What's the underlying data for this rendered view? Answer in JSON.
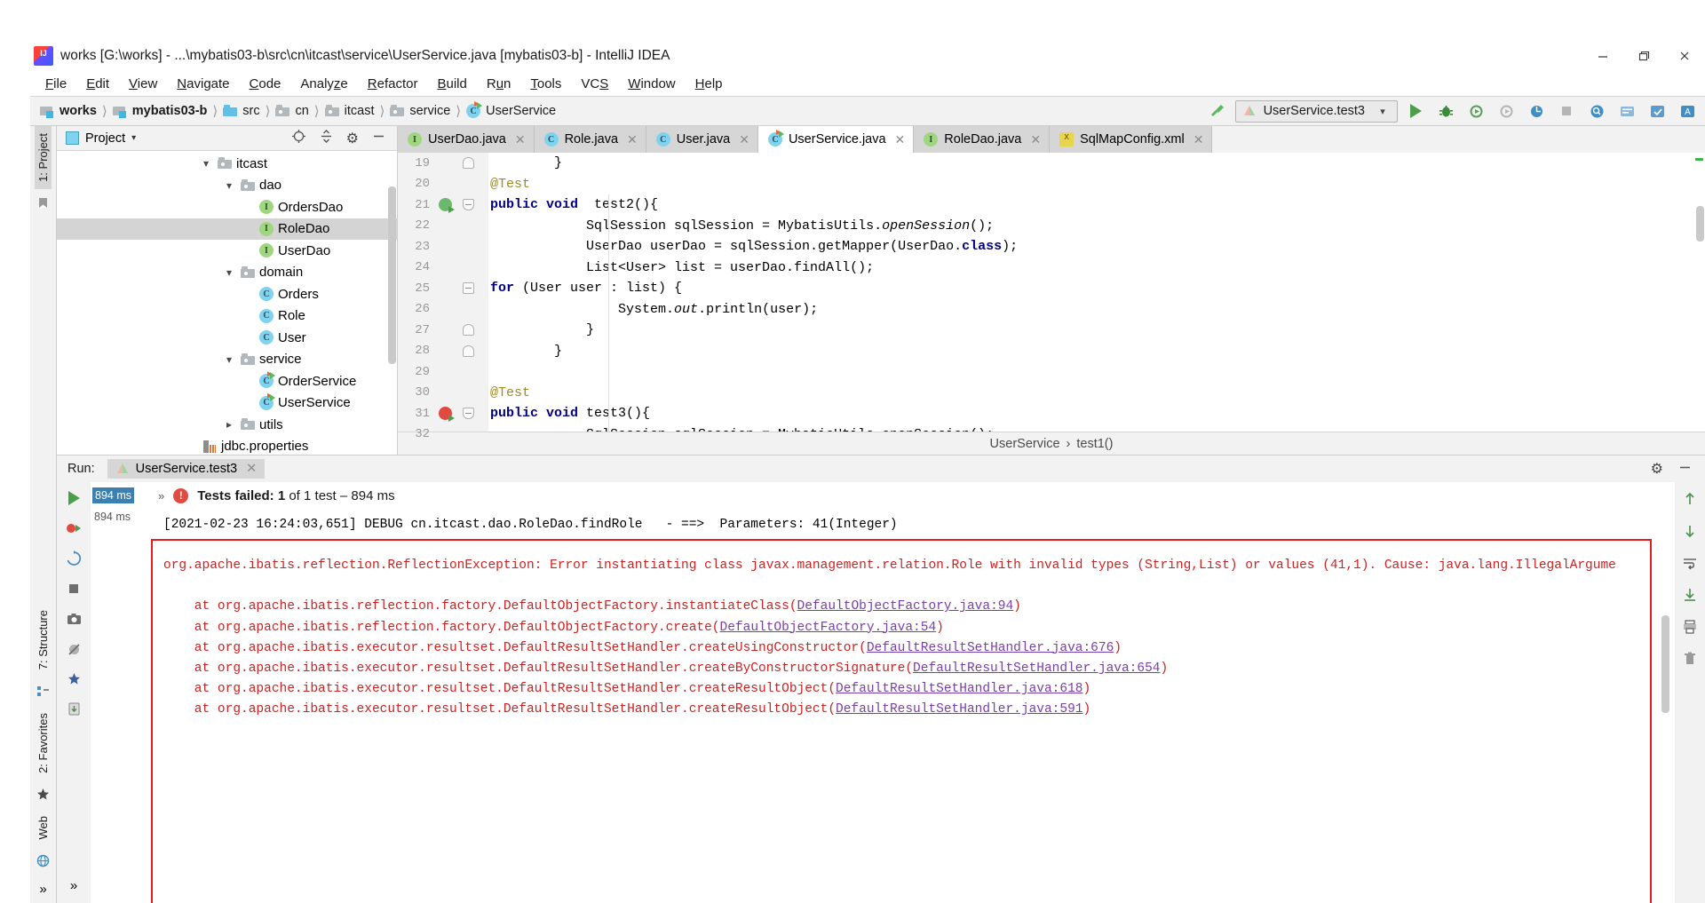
{
  "window": {
    "title": "works [G:\\works] - ...\\mybatis03-b\\src\\cn\\itcast\\service\\UserService.java [mybatis03-b] - IntelliJ IDEA",
    "app_icon": "intellij-idea-icon",
    "controls": {
      "minimize": "minimize-icon",
      "restore": "restore-icon",
      "close": "close-icon"
    }
  },
  "menubar": [
    {
      "label": "File",
      "mnemonic": "F"
    },
    {
      "label": "Edit",
      "mnemonic": "E"
    },
    {
      "label": "View",
      "mnemonic": "V"
    },
    {
      "label": "Navigate",
      "mnemonic": "N"
    },
    {
      "label": "Code",
      "mnemonic": "C"
    },
    {
      "label": "Analyze",
      "mnemonic": "z"
    },
    {
      "label": "Refactor",
      "mnemonic": "R"
    },
    {
      "label": "Build",
      "mnemonic": "B"
    },
    {
      "label": "Run",
      "mnemonic": "u"
    },
    {
      "label": "Tools",
      "mnemonic": "T"
    },
    {
      "label": "VCS",
      "mnemonic": "S"
    },
    {
      "label": "Window",
      "mnemonic": "W"
    },
    {
      "label": "Help",
      "mnemonic": "H"
    }
  ],
  "breadcrumb": [
    {
      "label": "works",
      "icon": "module-icon",
      "bold": true
    },
    {
      "label": "mybatis03-b",
      "icon": "module-icon",
      "bold": true
    },
    {
      "label": "src",
      "icon": "source-folder-icon",
      "bold": false
    },
    {
      "label": "cn",
      "icon": "package-folder-icon",
      "bold": false
    },
    {
      "label": "itcast",
      "icon": "package-folder-icon",
      "bold": false
    },
    {
      "label": "service",
      "icon": "package-folder-icon",
      "bold": false
    },
    {
      "label": "UserService",
      "icon": "java-class-runnable-icon",
      "bold": false
    }
  ],
  "toolbar": {
    "build_icon": "hammer-icon",
    "run_config": "UserService.test3",
    "run_config_icon": "junit-icon",
    "dropdown_icon": "chevron-down-icon",
    "run_icon": "run-icon",
    "debug_icon": "debug-icon",
    "run_coverage_icon": "run-with-coverage-icon",
    "profile_icon": "profile-icon",
    "stop_icon": "stop-icon",
    "search_icon": "search-everywhere-icon",
    "settings_icon": "settings-icon",
    "updates_icon": "updates-icon",
    "translate_icon": "translate-icon"
  },
  "left_strip": {
    "project_tab": "1: Project",
    "structure_tab": "7: Structure",
    "favorites_tab": "2: Favorites",
    "web_tab": "Web",
    "bookmark_icon": "bookmark-icon"
  },
  "project_panel": {
    "title": "Project",
    "title_icon": "project-view-icon",
    "dropdown_icon": "chevron-down-icon",
    "locate_icon": "scroll-from-source-icon",
    "collapse_icon": "collapse-all-icon",
    "settings_icon": "gear-icon",
    "hide_icon": "hide-icon",
    "tree": [
      {
        "label": "itcast",
        "icon": "package-folder-icon",
        "indent": 3,
        "chevron": "expanded",
        "selected": false
      },
      {
        "label": "dao",
        "icon": "package-folder-icon",
        "indent": 4,
        "chevron": "expanded",
        "selected": false
      },
      {
        "label": "OrdersDao",
        "icon": "interface-icon",
        "indent": 5,
        "chevron": "none",
        "selected": false
      },
      {
        "label": "RoleDao",
        "icon": "interface-icon",
        "indent": 5,
        "chevron": "none",
        "selected": true
      },
      {
        "label": "UserDao",
        "icon": "interface-icon",
        "indent": 5,
        "chevron": "none",
        "selected": false
      },
      {
        "label": "domain",
        "icon": "package-folder-icon",
        "indent": 4,
        "chevron": "expanded",
        "selected": false
      },
      {
        "label": "Orders",
        "icon": "class-icon",
        "indent": 5,
        "chevron": "none",
        "selected": false
      },
      {
        "label": "Role",
        "icon": "class-icon",
        "indent": 5,
        "chevron": "none",
        "selected": false
      },
      {
        "label": "User",
        "icon": "class-icon",
        "indent": 5,
        "chevron": "none",
        "selected": false
      },
      {
        "label": "service",
        "icon": "package-folder-icon",
        "indent": 4,
        "chevron": "expanded",
        "selected": false
      },
      {
        "label": "OrderService",
        "icon": "class-runnable-icon",
        "indent": 5,
        "chevron": "none",
        "selected": false
      },
      {
        "label": "UserService",
        "icon": "class-runnable-icon",
        "indent": 5,
        "chevron": "none",
        "selected": false
      },
      {
        "label": "utils",
        "icon": "package-folder-icon",
        "indent": 4,
        "chevron": "collapsed",
        "selected": false
      },
      {
        "label": "jdbc.properties",
        "icon": "properties-file-icon",
        "indent": 4,
        "chevron": "none",
        "selected": false
      }
    ]
  },
  "editor_tabs": [
    {
      "label": "UserDao.java",
      "icon": "interface-icon",
      "active": false
    },
    {
      "label": "Role.java",
      "icon": "class-icon",
      "active": false
    },
    {
      "label": "User.java",
      "icon": "class-icon",
      "active": false
    },
    {
      "label": "UserService.java",
      "icon": "class-runnable-icon",
      "active": true
    },
    {
      "label": "RoleDao.java",
      "icon": "interface-icon",
      "active": false
    },
    {
      "label": "SqlMapConfig.xml",
      "icon": "xml-file-icon",
      "active": false
    }
  ],
  "editor": {
    "lines": [
      {
        "num": "19",
        "fold": "end",
        "gutter_run": "none",
        "html": "        }"
      },
      {
        "num": "20",
        "fold": "none",
        "gutter_run": "none",
        "html": "        <span class=\"ann\">@Test</span>"
      },
      {
        "num": "21",
        "fold": "start",
        "gutter_run": "ok",
        "html": "        <span class=\"kw\">public void</span>  test2(){"
      },
      {
        "num": "22",
        "fold": "none",
        "gutter_run": "none",
        "html": "            SqlSession sqlSession = MybatisUtils.<span class=\"itl\">openSession</span>();"
      },
      {
        "num": "23",
        "fold": "none",
        "gutter_run": "none",
        "html": "            UserDao userDao = sqlSession.getMapper(UserDao.<span class=\"kw\">class</span>);"
      },
      {
        "num": "24",
        "fold": "none",
        "gutter_run": "none",
        "html": "            List&lt;User&gt; list = userDao.findAll();"
      },
      {
        "num": "25",
        "fold": "start",
        "gutter_run": "none",
        "html": "            <span class=\"kw\">for</span> (User user : list) {"
      },
      {
        "num": "26",
        "fold": "none",
        "gutter_run": "none",
        "html": "                System.<span class=\"itl\">out</span>.println(user);"
      },
      {
        "num": "27",
        "fold": "end",
        "gutter_run": "none",
        "html": "            }"
      },
      {
        "num": "28",
        "fold": "end",
        "gutter_run": "none",
        "html": "        }"
      },
      {
        "num": "29",
        "fold": "none",
        "gutter_run": "none",
        "html": ""
      },
      {
        "num": "30",
        "fold": "none",
        "gutter_run": "none",
        "html": "        <span class=\"ann\">@Test</span>"
      },
      {
        "num": "31",
        "fold": "start",
        "gutter_run": "fail",
        "html": "        <span class=\"kw\">public void</span> test3(){"
      },
      {
        "num": "32",
        "fold": "none",
        "gutter_run": "none",
        "html": "            SqlSession sqlSession = MybatisUtils.openSession();"
      }
    ],
    "breadcrumb": [
      "UserService",
      "test1()"
    ],
    "breadcrumb_sep": "›"
  },
  "run_window": {
    "label": "Run:",
    "tab_label": "UserService.test3",
    "tab_icon": "junit-icon",
    "tab_close_icon": "close-icon",
    "settings_icon": "gear-icon",
    "hide_icon": "hide-icon",
    "left_toolbar": [
      "rerun-icon",
      "rerun-failed-icon",
      "toggle-auto-test-icon",
      "stop-icon",
      "screenshot-icon",
      "mute-breakpoints-icon",
      "filter-passed-icon",
      "export-icon",
      "expand-icon"
    ],
    "right_toolbar": [
      "scroll-up-icon",
      "scroll-down-icon",
      "wrap-text-icon",
      "scroll-to-end-icon",
      "print-icon",
      "trash-icon"
    ],
    "status": {
      "expand_icon": "chevron-right-icon",
      "fail_icon": "test-failed-icon",
      "failed_label": "Tests failed:",
      "failed_count": "1",
      "of_label": "of 1 test",
      "duration": "894 ms"
    },
    "test_tree": {
      "badge_time": "894 ms",
      "node_time": "894 ms"
    },
    "console_lines": [
      {
        "text": "[2021-02-23 16:24:03,651] DEBUG cn.itcast.dao.RoleDao.findRole   - ==>  Parameters: 41(Integer)",
        "error": false
      },
      {
        "text": "",
        "error": false
      },
      {
        "text": "org.apache.ibatis.reflection.ReflectionException: Error instantiating class javax.management.relation.Role with invalid types (String,List) or values (41,1). Cause: java.lang.IllegalArgume",
        "error": true
      },
      {
        "text": "",
        "error": true
      },
      {
        "text": "    at org.apache.ibatis.reflection.factory.DefaultObjectFactory.instantiateClass(DefaultObjectFactory.java:94)",
        "error": true,
        "link": "DefaultObjectFactory.java:94"
      },
      {
        "text": "    at org.apache.ibatis.reflection.factory.DefaultObjectFactory.create(DefaultObjectFactory.java:54)",
        "error": true,
        "link": "DefaultObjectFactory.java:54"
      },
      {
        "text": "    at org.apache.ibatis.executor.resultset.DefaultResultSetHandler.createUsingConstructor(DefaultResultSetHandler.java:676)",
        "error": true,
        "link": "DefaultResultSetHandler.java:676"
      },
      {
        "text": "    at org.apache.ibatis.executor.resultset.DefaultResultSetHandler.createByConstructorSignature(DefaultResultSetHandler.java:654)",
        "error": true,
        "link": "DefaultResultSetHandler.java:654"
      },
      {
        "text": "    at org.apache.ibatis.executor.resultset.DefaultResultSetHandler.createResultObject(DefaultResultSetHandler.java:618)",
        "error": true,
        "link": "DefaultResultSetHandler.java:618"
      },
      {
        "text": "    at org.apache.ibatis.executor.resultset.DefaultResultSetHandler.createResultObject(DefaultResultSetHandler.java:591)",
        "error": true,
        "link": "DefaultResultSetHandler.java:591"
      }
    ]
  },
  "colors": {
    "error_border": "#e02020",
    "error_text": "#cc2222",
    "link": "#7a3ea8",
    "accent_green": "#4c9e4c",
    "selection": "#d4d4d4",
    "panel_bg": "#f2f2f2"
  }
}
